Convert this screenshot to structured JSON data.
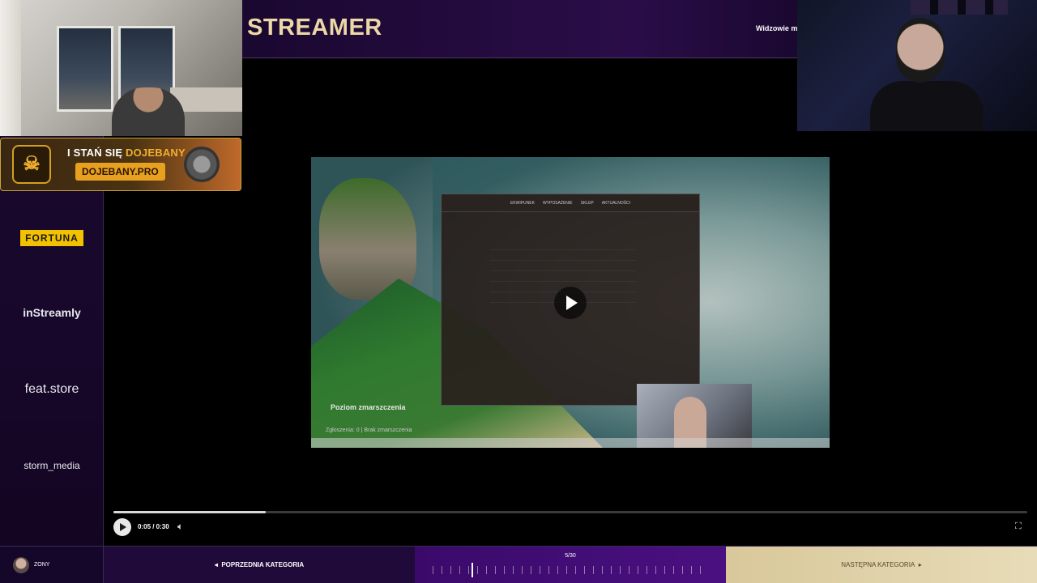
{
  "header": {
    "title": "STREAMER",
    "viewers_text": "Widzowie mog"
  },
  "promo": {
    "text_prefix": "I STAŃ SIĘ",
    "text_accent": "DOJEBANY",
    "button": "DOJEBANY.PRO"
  },
  "sidebar": {
    "sponsors": [
      "FORTUNA",
      "inStreamly",
      "feat.store",
      "storm_media"
    ]
  },
  "video": {
    "overlay_title": "Poziom zmarszczenia",
    "overlay_sub": "Zgłoszenia: 0 | Brak zmarszczenia",
    "app_tabs": [
      "EKWIPUNEK",
      "WYPOSAŻENIE",
      "SKLEP",
      "AKTUALNOŚCI"
    ]
  },
  "player": {
    "time": "0:05 / 0:30",
    "progress": 0.167
  },
  "bottom": {
    "username": "ZONY",
    "prev_label": "POPRZEDNIA KATEGORIA",
    "counter": "5/30",
    "next_label": "NASTĘPNA KATEGORIA"
  },
  "icons": {
    "play": "play-icon",
    "volume": "volume-icon",
    "fullscreen": "fullscreen-icon",
    "arrow_left": "arrow-left-icon",
    "arrow_right": "arrow-right-icon"
  }
}
